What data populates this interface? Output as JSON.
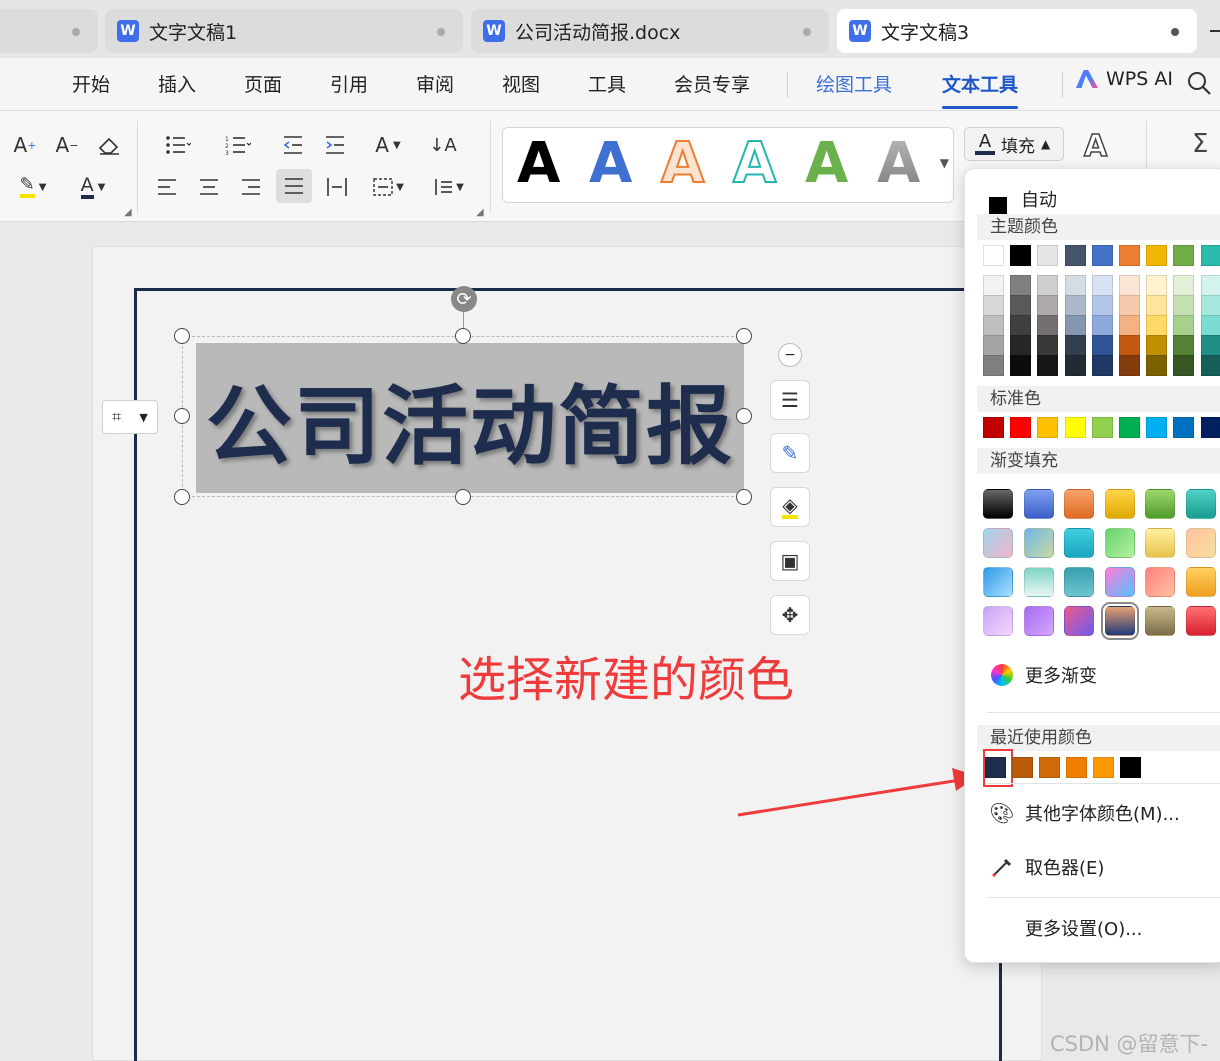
{
  "tabs": [
    {
      "label": "",
      "active": false
    },
    {
      "label": "文字文稿1",
      "active": false
    },
    {
      "label": "公司活动简报.docx",
      "active": false
    },
    {
      "label": "文字文稿3",
      "active": true
    }
  ],
  "menu": {
    "items": [
      "开始",
      "插入",
      "页面",
      "引用",
      "审阅",
      "视图",
      "工具",
      "会员专享"
    ],
    "context_tabs": [
      "绘图工具",
      "文本工具"
    ],
    "active": "文本工具",
    "ai_label": "WPS AI"
  },
  "ribbon": {
    "fill_label": "填充",
    "style_colors": [
      "#000000",
      "#3f6fd1",
      "#ed7d31",
      "#26b6b0",
      "#6ab04c",
      "#7a7a7a"
    ],
    "style_letter": "A"
  },
  "document": {
    "title": "公司活动简报",
    "title_color": "#1e2d4d"
  },
  "annotation": "选择新建的颜色",
  "dropdown": {
    "auto_label": "自动",
    "theme_label": "主题颜色",
    "theme_top": [
      "#ffffff",
      "#000000",
      "#e7e6e6",
      "#44546a",
      "#4472c4",
      "#ed7d31",
      "#f2b705",
      "#70ad47",
      "#2bbbad"
    ],
    "theme_shades": [
      [
        "#f2f2f2",
        "#7f7f7f",
        "#d0cece",
        "#d6dce4",
        "#d9e2f3",
        "#fbe5d5",
        "#fff2cc",
        "#e2efd9",
        "#d3f3ef"
      ],
      [
        "#d8d8d8",
        "#595959",
        "#aeaaaa",
        "#adb9ca",
        "#b4c6e7",
        "#f7caac",
        "#fee599",
        "#c5e0b3",
        "#a6e7e0"
      ],
      [
        "#bfbfbf",
        "#3f3f3f",
        "#757070",
        "#8496b0",
        "#8eaadb",
        "#f4b183",
        "#ffd965",
        "#a8d08d",
        "#7adbd1"
      ],
      [
        "#a5a5a5",
        "#262626",
        "#3a3838",
        "#323f4f",
        "#2f5496",
        "#c45911",
        "#bf9000",
        "#538135",
        "#1f8f85"
      ],
      [
        "#7f7f7f",
        "#0c0c0c",
        "#161616",
        "#222a35",
        "#1f3864",
        "#833c0b",
        "#7f6000",
        "#375623",
        "#155f58"
      ]
    ],
    "standard_label": "标准色",
    "standard": [
      "#c00000",
      "#ff0000",
      "#ffc000",
      "#ffff00",
      "#92d050",
      "#00b050",
      "#00b0f0",
      "#0070c0",
      "#002060"
    ],
    "gradient_label": "渐变填充",
    "gradients": [
      [
        "linear-gradient(#666,#000)",
        "linear-gradient(#7fa0f0,#3a5fc8)",
        "linear-gradient(#f7a36a,#e06a24)",
        "linear-gradient(#ffd54a,#e0a800)",
        "linear-gradient(#9ed86e,#4f9a2a)",
        "linear-gradient(#4fd1c5,#1a9e92)"
      ],
      [
        "linear-gradient(135deg,#9fd5ee,#f4b3c8)",
        "linear-gradient(135deg,#6fb6e8,#c9d9a0)",
        "linear-gradient(#3fd0e0,#1ba5c0)",
        "linear-gradient(135deg,#63d36c,#b9f0a0)",
        "linear-gradient(#fff0a0,#e7c24c)",
        "linear-gradient(135deg,#ffc2a0,#f7e0a0)"
      ],
      [
        "linear-gradient(135deg,#2f9ae8,#a8e0ff)",
        "linear-gradient(#7fd3c5,#e8f7f4)",
        "linear-gradient(#3a9fb0,#6cc6d0)",
        "linear-gradient(135deg,#ff7ad8,#4fc3ff)",
        "linear-gradient(135deg,#ff8080,#ffc2a0)",
        "linear-gradient(#ffd060,#f0a020)"
      ],
      [
        "linear-gradient(135deg,#c7a6f5,#f4d6ff)",
        "linear-gradient(135deg,#a66bf0,#d6a6ff)",
        "linear-gradient(135deg,#f05a8c,#6a5cf0)",
        "linear-gradient(#e8a070,#1f3a7a)",
        "linear-gradient(#c9b98a,#7a6d4a)",
        "linear-gradient(#ff7070,#d82030)"
      ]
    ],
    "more_gradient": "更多渐变",
    "recent_label": "最近使用颜色",
    "recent": [
      "#1e2d4d",
      "#b85c0a",
      "#d06a0a",
      "#f08000",
      "#ff9a00",
      "#000000"
    ],
    "other_colors": "其他字体颜色(M)...",
    "eyedropper": "取色器(E)",
    "more_settings": "更多设置(O)..."
  },
  "watermark": "CSDN @留意下-"
}
